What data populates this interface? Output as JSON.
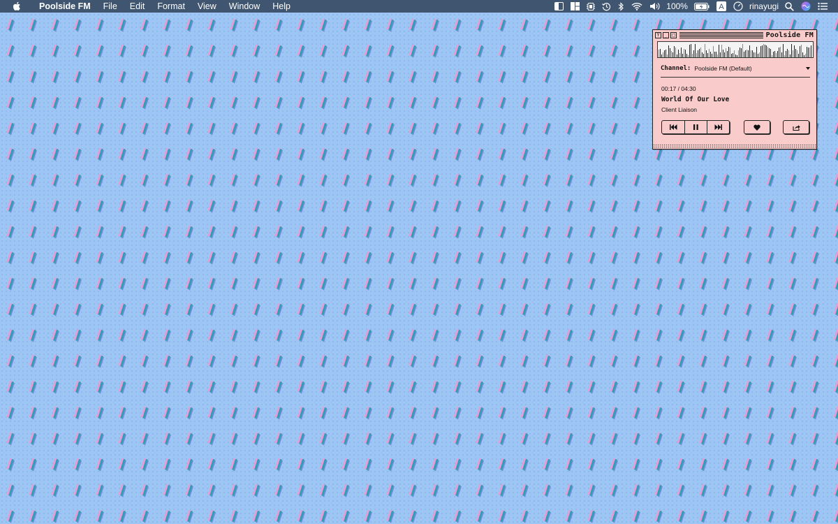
{
  "menubar": {
    "apple_icon": "apple-logo-icon",
    "app_name": "Poolside FM",
    "menus": [
      "File",
      "Edit",
      "Format",
      "View",
      "Window",
      "Help"
    ],
    "battery_percent": "100%",
    "input_source": "A",
    "username": "rinayugi",
    "tray_icons": [
      "sidebar-icon",
      "window-layout-icon",
      "memory-icon",
      "time-machine-icon",
      "bluetooth-icon",
      "wifi-icon",
      "volume-icon",
      "battery-charging-icon",
      "input-source-icon",
      "clock-icon",
      "search-icon",
      "siri-icon",
      "notification-center-icon"
    ]
  },
  "player": {
    "title": "Poolside FM",
    "titlebar_buttons": [
      "Y",
      "_",
      "□"
    ],
    "channel_label": "Channel:",
    "channel_value": "Poolside FM (Default)",
    "time": "00:17 / 04:30",
    "track_title": "World Of Our Love",
    "artist": "Client Liaison",
    "controls": [
      "previous-icon",
      "pause-icon",
      "next-icon",
      "heart-icon",
      "share-icon"
    ]
  },
  "colors": {
    "menubar_bg": "#3f5570",
    "desktop_bg": "#9ec6f4",
    "window_bg": "#f9cbca",
    "pattern_teal": "#2aa1b4",
    "pattern_pink": "#e39ed6"
  }
}
